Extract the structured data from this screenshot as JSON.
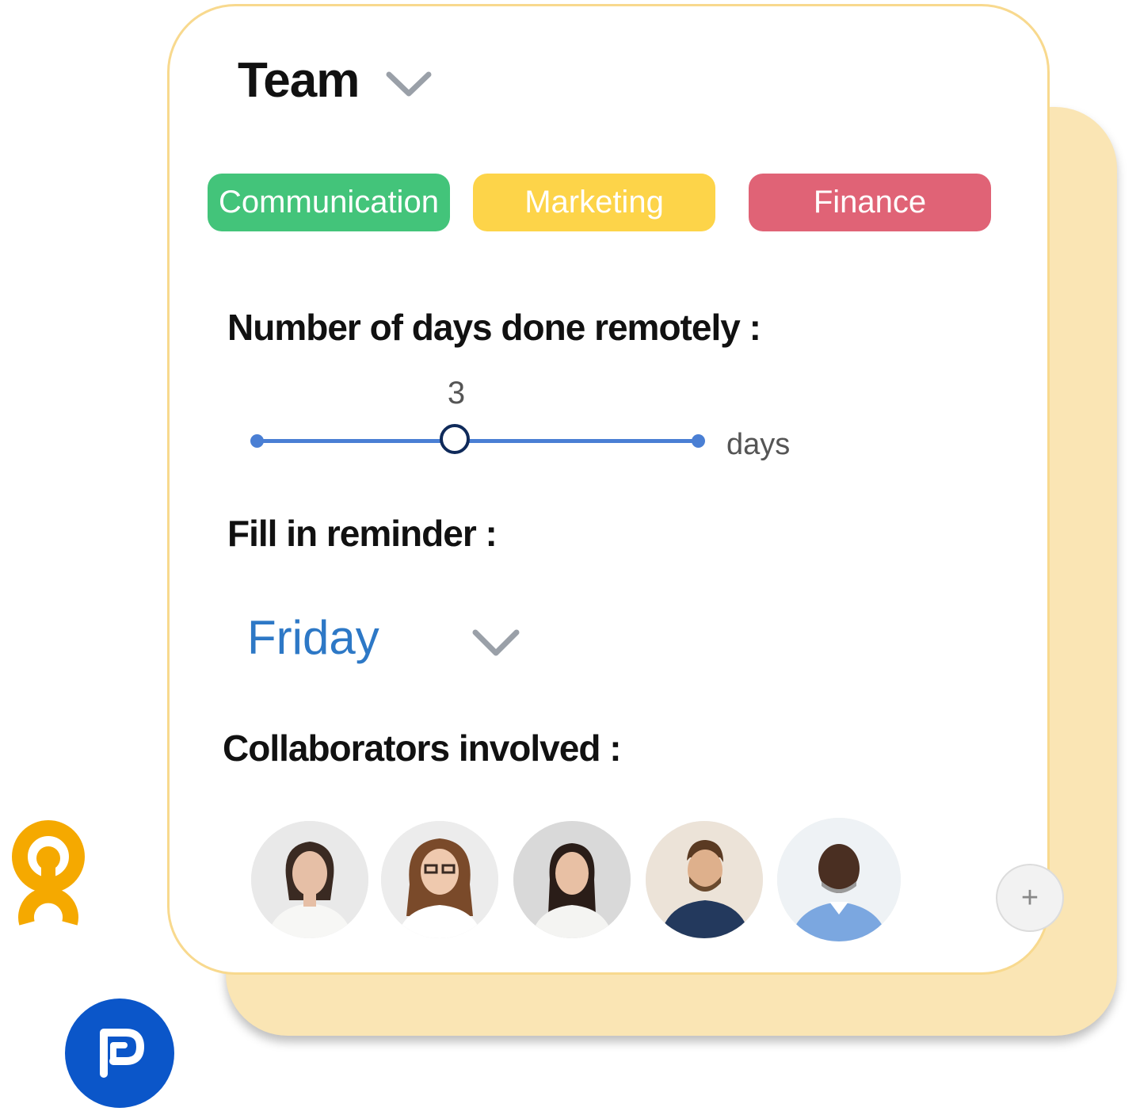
{
  "team_select": {
    "title": "Team",
    "chevron_icon": "chevron-down-icon"
  },
  "tags": [
    {
      "label": "Communication",
      "color": "#43c47a"
    },
    {
      "label": "Marketing",
      "color": "#fdd449"
    },
    {
      "label": "Finance",
      "color": "#e06376"
    }
  ],
  "remote_days": {
    "label": "Number of days done remotely :",
    "value": "3",
    "min": 0,
    "max": 7,
    "unit": "days",
    "accent_color": "#4a7fd4"
  },
  "reminder": {
    "label": "Fill in reminder :",
    "selected_day": "Friday",
    "chevron_icon": "chevron-down-icon"
  },
  "collaborators": {
    "label": "Collaborators involved :",
    "avatars": [
      {
        "icon": "avatar-woman-dark-hair"
      },
      {
        "icon": "avatar-woman-glasses"
      },
      {
        "icon": "avatar-woman-long-hair"
      },
      {
        "icon": "avatar-man-beard"
      },
      {
        "icon": "avatar-man-blue-shirt"
      }
    ],
    "add_label": "+"
  },
  "logos": {
    "orange_logo": "orange-ring-logo",
    "blue_logo": "blue-p-logo"
  }
}
